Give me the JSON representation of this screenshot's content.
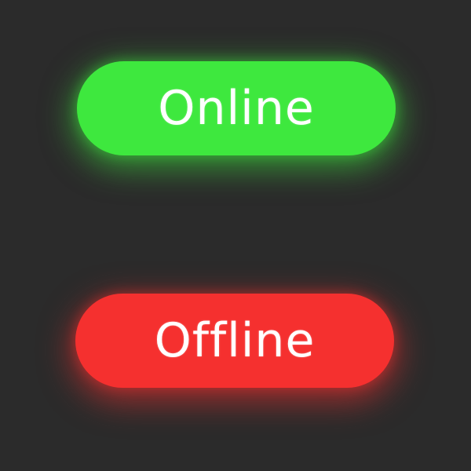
{
  "statuses": {
    "online": {
      "label": "Online",
      "color": "#3ee83e"
    },
    "offline": {
      "label": "Offline",
      "color": "#f5302f"
    }
  },
  "background_color": "#2b2b2b"
}
